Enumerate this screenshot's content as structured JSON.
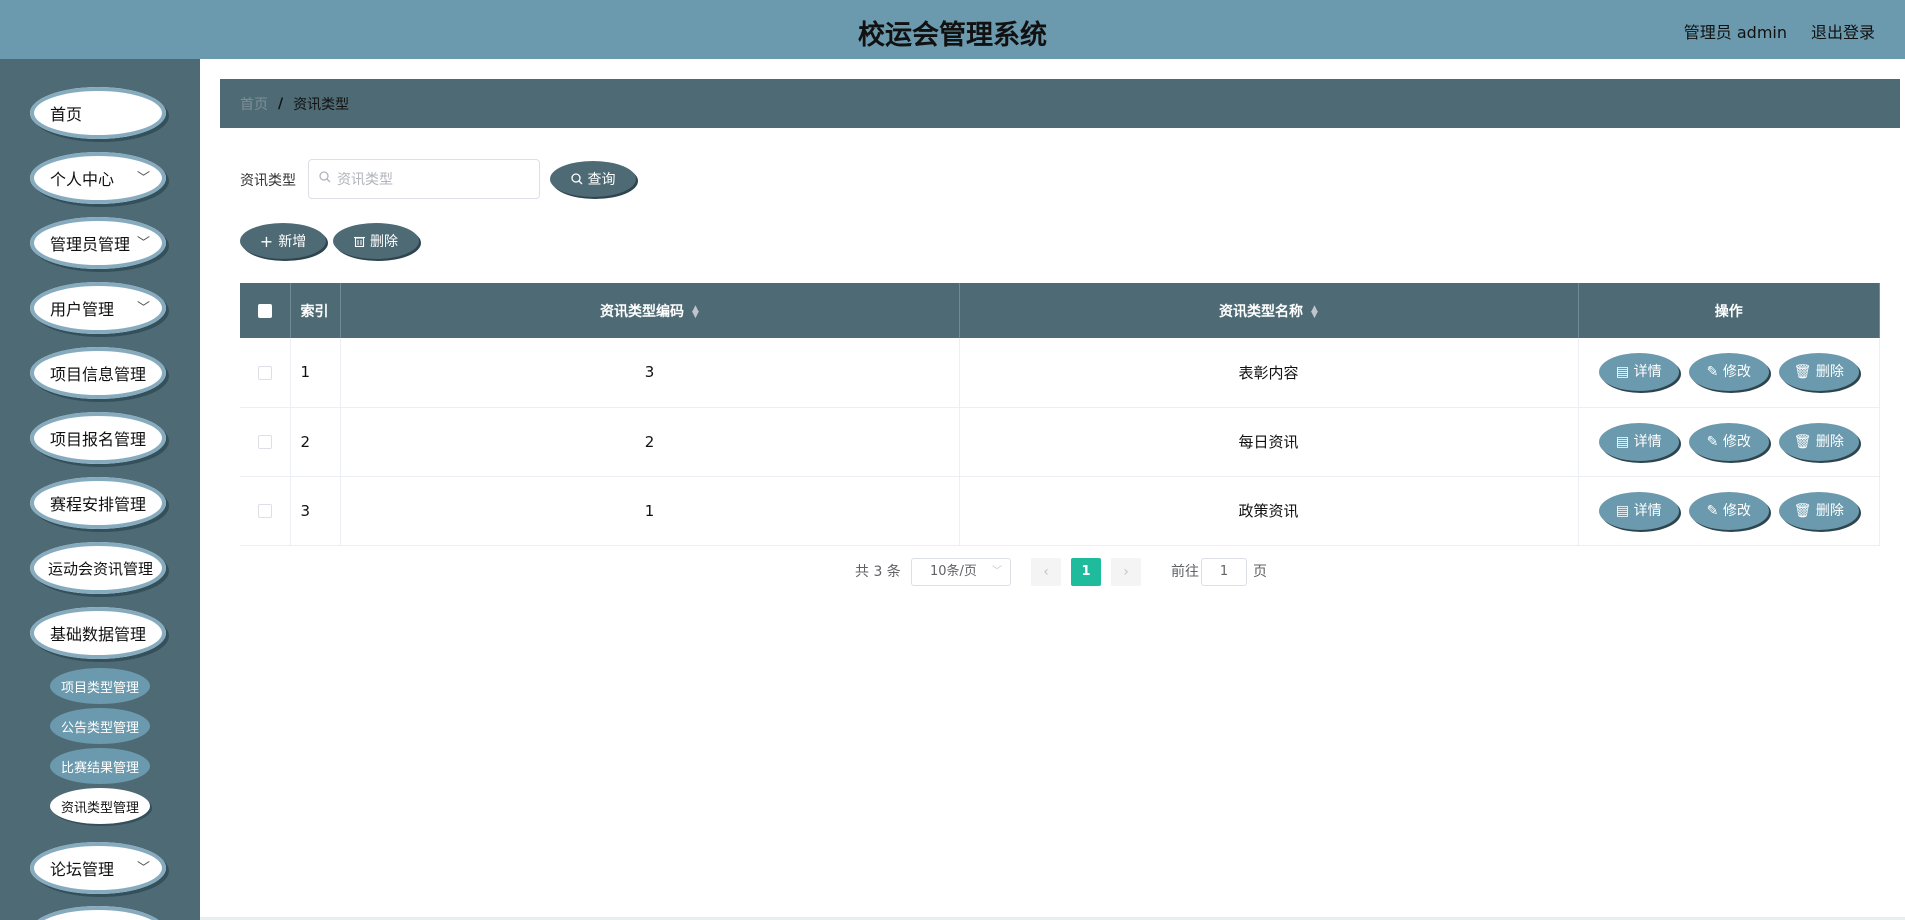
{
  "header": {
    "title": "校运会管理系统",
    "user": "管理员 admin",
    "logout": "退出登录"
  },
  "sidebar": {
    "items": [
      {
        "label": "首页"
      },
      {
        "label": "个人中心",
        "chevron": true
      },
      {
        "label": "管理员管理",
        "chevron": true
      },
      {
        "label": "用户管理",
        "chevron": true
      },
      {
        "label": "项目信息管理"
      },
      {
        "label": "项目报名管理"
      },
      {
        "label": "赛程安排管理"
      },
      {
        "label": "运动会资讯管理"
      },
      {
        "label": "基础数据管理"
      },
      {
        "label": "论坛管理",
        "chevron": true
      }
    ],
    "sub_items": [
      {
        "label": "项目类型管理"
      },
      {
        "label": "公告类型管理"
      },
      {
        "label": "比赛结果管理"
      },
      {
        "label": "资讯类型管理",
        "active": true
      }
    ]
  },
  "breadcrumb": {
    "home": "首页",
    "separator": "/",
    "current": "资讯类型"
  },
  "search": {
    "label": "资讯类型",
    "placeholder": "资讯类型",
    "button": "查询"
  },
  "toolbar": {
    "add": "新增",
    "delete": "删除"
  },
  "table": {
    "columns": [
      "索引",
      "资讯类型编码",
      "资讯类型名称",
      "操作"
    ],
    "rows": [
      {
        "index": "1",
        "code": "3",
        "name": "表彰内容"
      },
      {
        "index": "2",
        "code": "2",
        "name": "每日资讯"
      },
      {
        "index": "3",
        "code": "1",
        "name": "政策资讯"
      }
    ],
    "actions": {
      "detail": "详情",
      "edit": "修改",
      "delete": "删除"
    }
  },
  "pagination": {
    "total": "共 3 条",
    "page_size": "10条/页",
    "current_page": "1",
    "goto_label": "前往",
    "goto_value": "1",
    "page_suffix": "页"
  },
  "colors": {
    "header": "#6b9aae",
    "sidebar": "#4e6a75",
    "accent": "#1ebc9c"
  }
}
